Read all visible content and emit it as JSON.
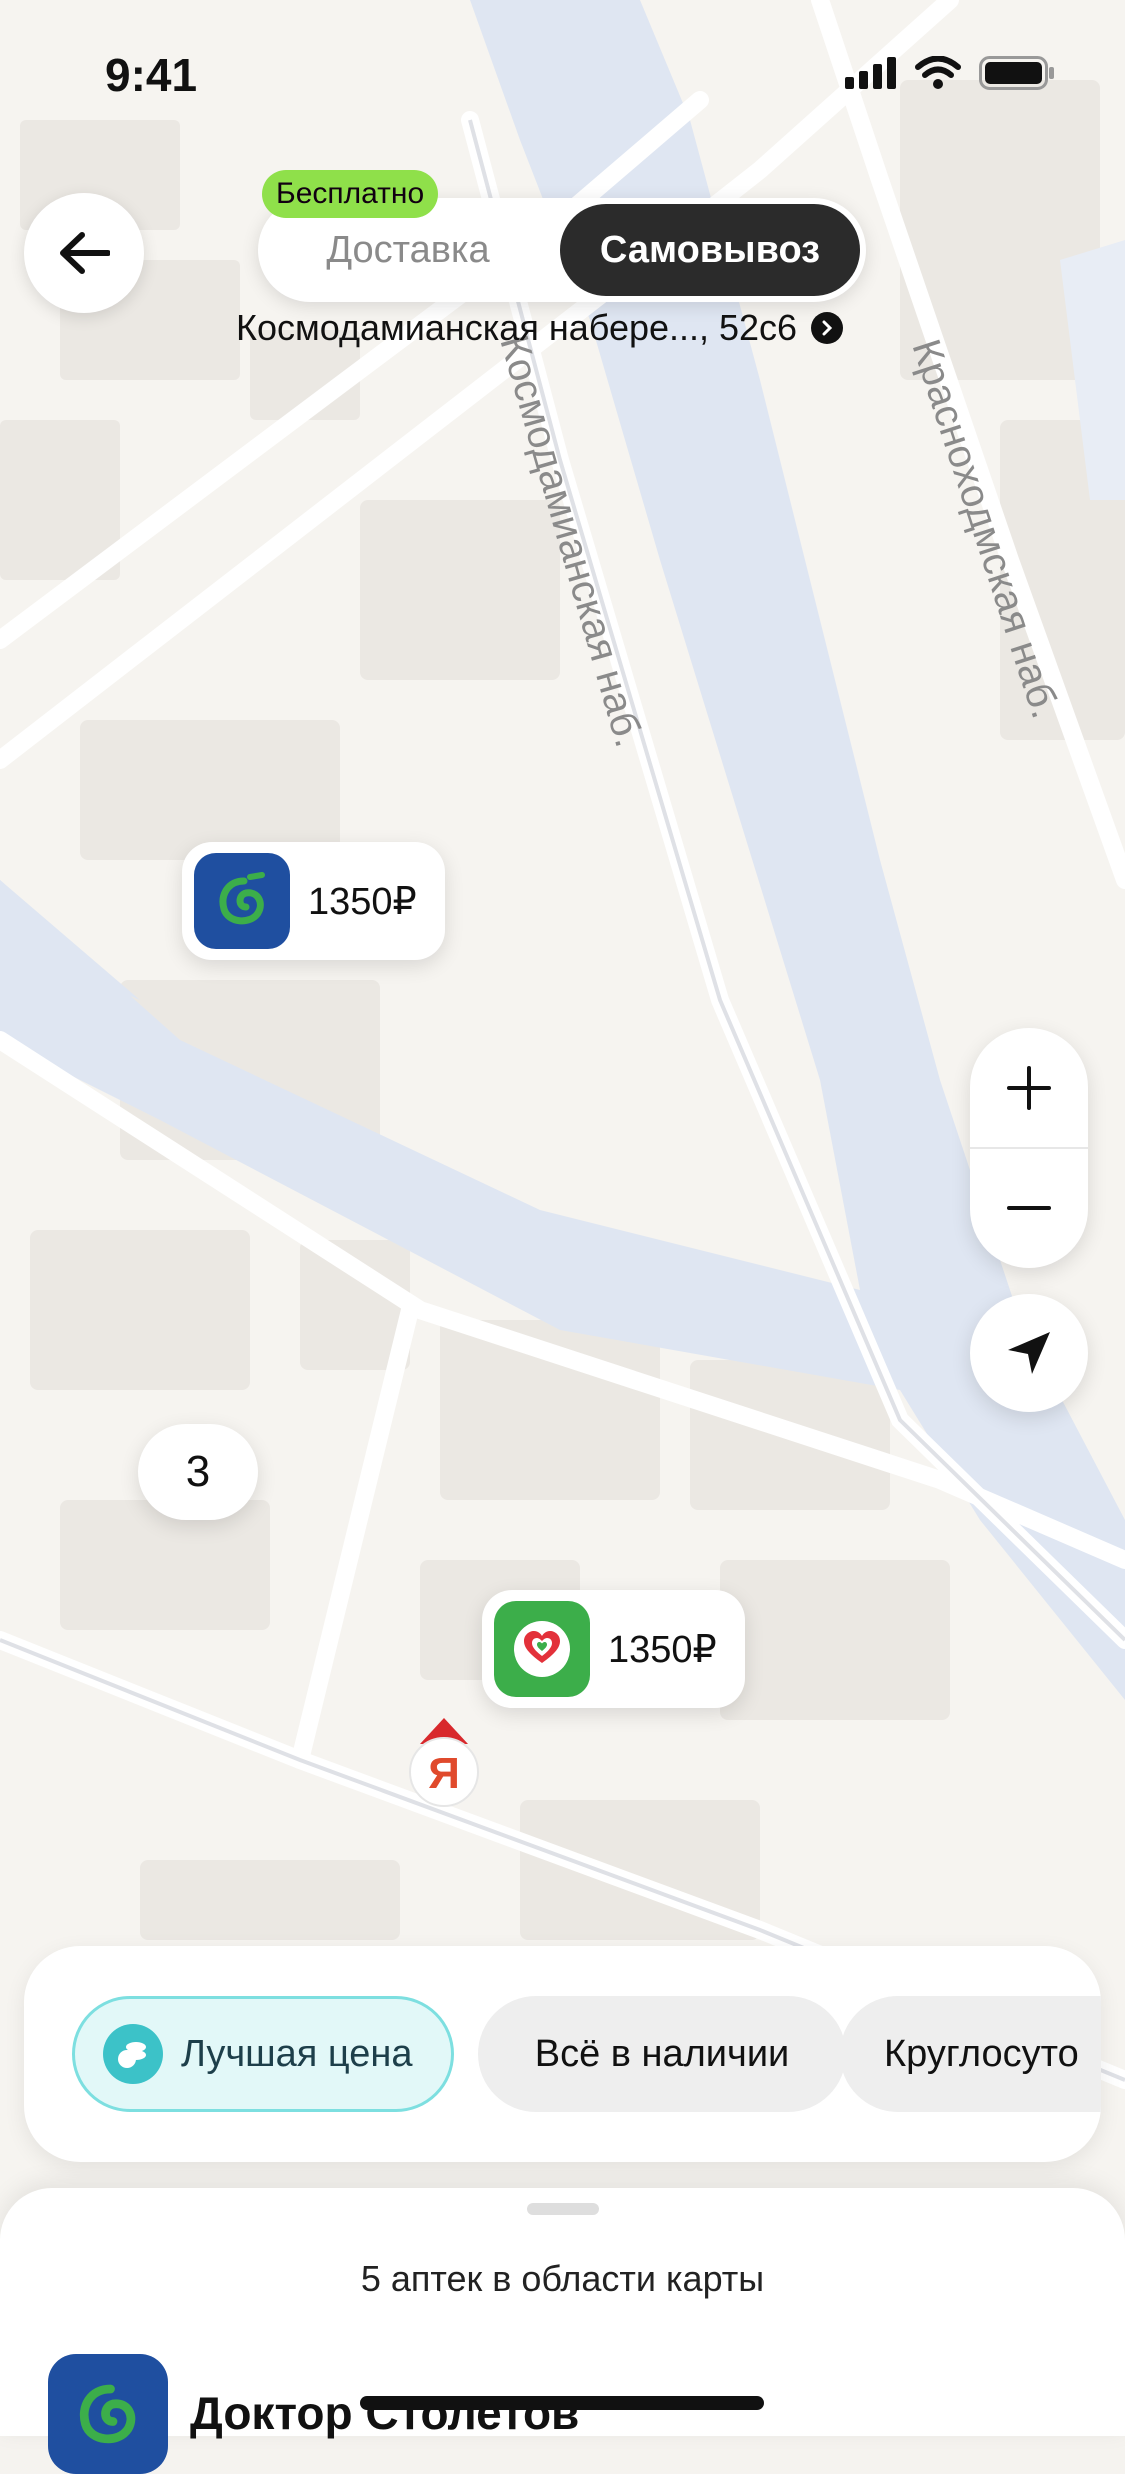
{
  "status_bar": {
    "time": "9:41"
  },
  "header": {
    "free_badge": "Бесплатно",
    "mode_delivery": "Доставка",
    "mode_pickup": "Самовывоз",
    "address": "Космодамианская набере..., 52с6"
  },
  "map": {
    "streets": [
      "Космодамианская наб.",
      "Красноходмская наб."
    ],
    "pins": [
      {
        "brand_icon": "doctor-stoletov-logo",
        "price": "1350₽"
      },
      {
        "brand_icon": "heart-pharmacy-logo",
        "price": "1350₽"
      }
    ],
    "cluster_count": "3",
    "zoom_in_label": "+",
    "zoom_out_label": "−"
  },
  "filters": {
    "chips": [
      "Лучшая цена",
      "Всё в наличии",
      "Круглосуто"
    ]
  },
  "sheet": {
    "title": "5 аптек в области карты",
    "first_pharmacy": "Доктор Столетов"
  },
  "colors": {
    "accent_green": "#8fe04a",
    "pickup_dark": "#2b2b2b",
    "chip_selected_bg": "#e2f8f8",
    "chip_selected_border": "#7ddfe0",
    "river": "#dfe6f2",
    "brand_blue": "#1f4fa0",
    "brand_green": "#3cae4a"
  }
}
